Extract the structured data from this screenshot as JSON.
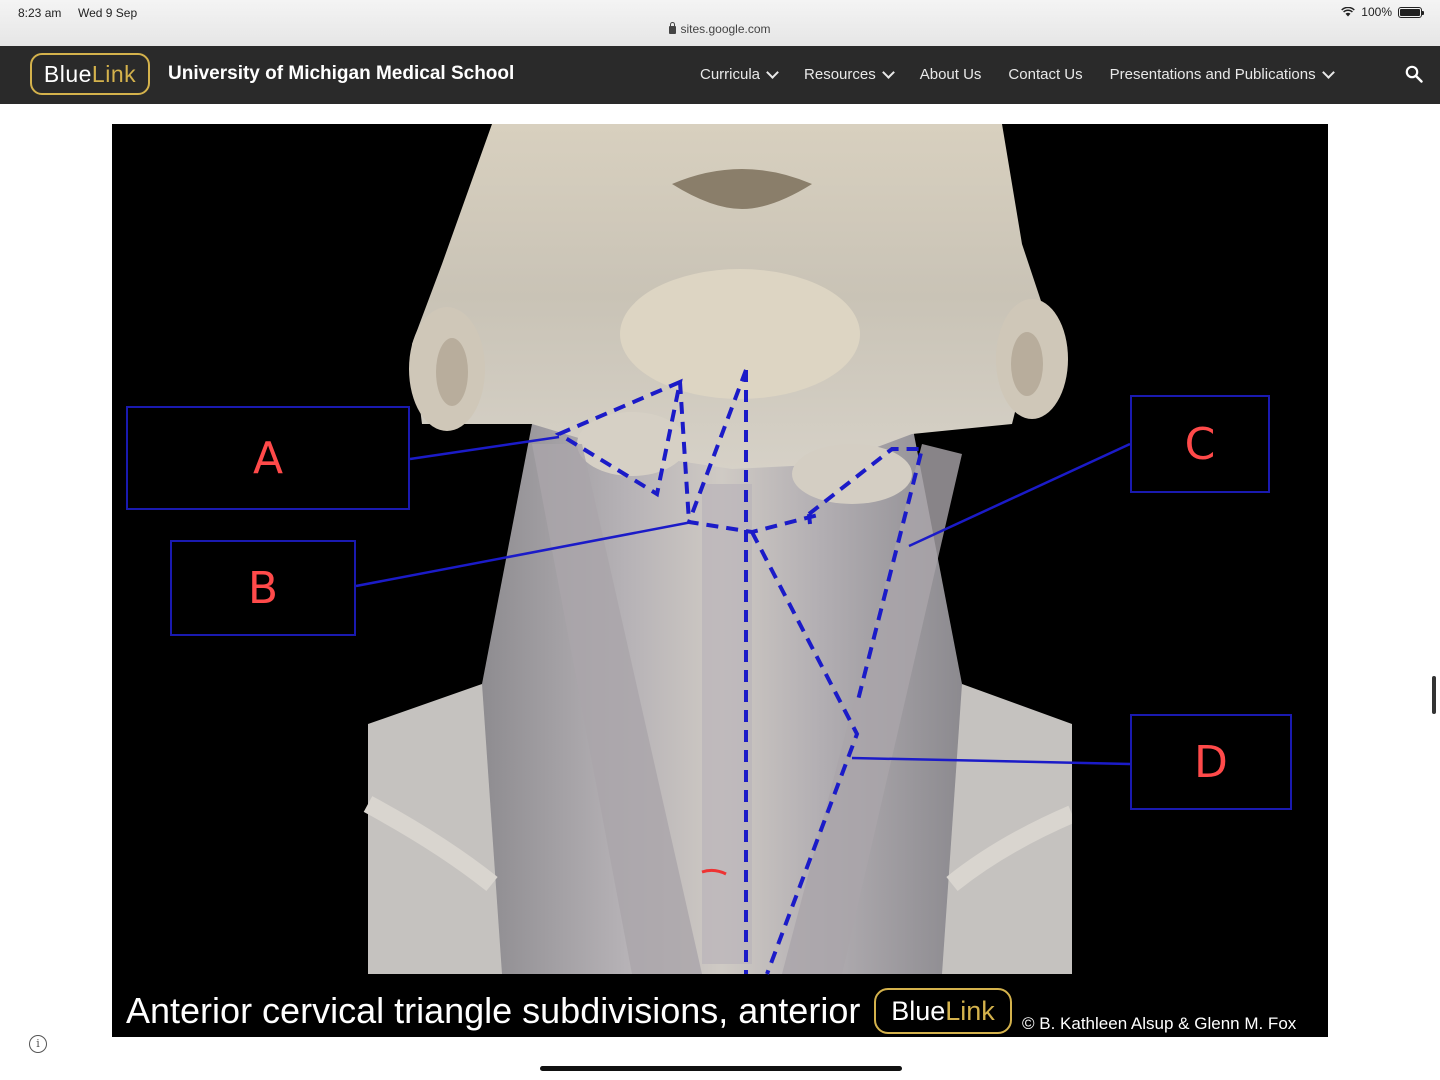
{
  "status_bar": {
    "time": "8:23 am",
    "date": "Wed 9 Sep",
    "url": "sites.google.com",
    "battery": "100%",
    "icons": [
      "lock-icon",
      "wifi-icon",
      "battery-icon"
    ]
  },
  "nav": {
    "logo_part1": "Blue",
    "logo_part2": "Link",
    "site_title": "University of Michigan Medical School",
    "items": [
      {
        "label": "Curricula",
        "has_dropdown": true
      },
      {
        "label": "Resources",
        "has_dropdown": true
      },
      {
        "label": "About Us",
        "has_dropdown": false
      },
      {
        "label": "Contact Us",
        "has_dropdown": false
      },
      {
        "label": "Presentations and Publications",
        "has_dropdown": true
      }
    ],
    "search_icon": "search-icon"
  },
  "figure": {
    "caption": "Anterior cervical triangle subdivisions, anterior",
    "logo_part1": "Blue",
    "logo_part2": "Link",
    "copyright": "© B. Kathleen Alsup & Glenn M. Fox",
    "labels": [
      "A",
      "B",
      "C",
      "D"
    ]
  },
  "colors": {
    "nav_bg": "#2a2a2a",
    "brand_gold": "#d4b24c",
    "label_box": "#1a1ab0",
    "label_text": "#ff4a4a"
  }
}
